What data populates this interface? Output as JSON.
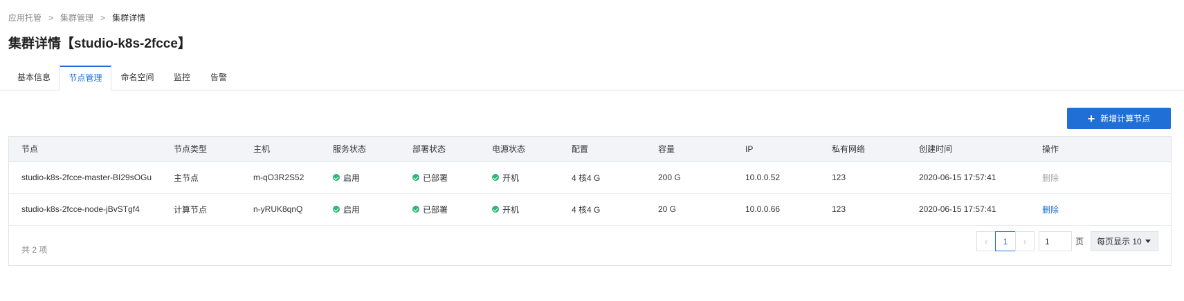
{
  "breadcrumb": {
    "items": [
      "应用托管",
      "集群管理"
    ],
    "separator": ">",
    "current": "集群详情"
  },
  "page_title": "集群详情【studio-k8s-2fcce】",
  "tabs": [
    {
      "label": "基本信息",
      "active": false
    },
    {
      "label": "节点管理",
      "active": true
    },
    {
      "label": "命名空间",
      "active": false
    },
    {
      "label": "监控",
      "active": false
    },
    {
      "label": "告警",
      "active": false
    }
  ],
  "add_button": {
    "label": "新增计算节点",
    "icon": "plus-icon"
  },
  "table": {
    "columns": [
      "节点",
      "节点类型",
      "主机",
      "服务状态",
      "部署状态",
      "电源状态",
      "配置",
      "容量",
      "IP",
      "私有网络",
      "创建时间",
      "操作"
    ],
    "rows": [
      {
        "node": "studio-k8s-2fcce-master-BI29sOGu",
        "type": "主节点",
        "host": "m-qO3R2S52",
        "service": "启用",
        "deploy": "已部署",
        "power": "开机",
        "config": "4 核4 G",
        "capacity": "200 G",
        "ip": "10.0.0.52",
        "vpc": "123",
        "created": "2020-06-15 17:57:41",
        "action": "删除",
        "action_enabled": false
      },
      {
        "node": "studio-k8s-2fcce-node-jBvSTgf4",
        "type": "计算节点",
        "host": "n-yRUK8qnQ",
        "service": "启用",
        "deploy": "已部署",
        "power": "开机",
        "config": "4 核4 G",
        "capacity": "20 G",
        "ip": "10.0.0.66",
        "vpc": "123",
        "created": "2020-06-15 17:57:41",
        "action": "删除",
        "action_enabled": true
      }
    ],
    "total": "共 2 项"
  },
  "pagination": {
    "prev": "‹",
    "next": "›",
    "current_page": "1",
    "jump_value": "1",
    "page_label": "页",
    "page_size": "每页显示 10"
  },
  "colors": {
    "accent": "#1f6fd6",
    "success": "#2bb673",
    "header_bg": "#f2f4f7"
  }
}
